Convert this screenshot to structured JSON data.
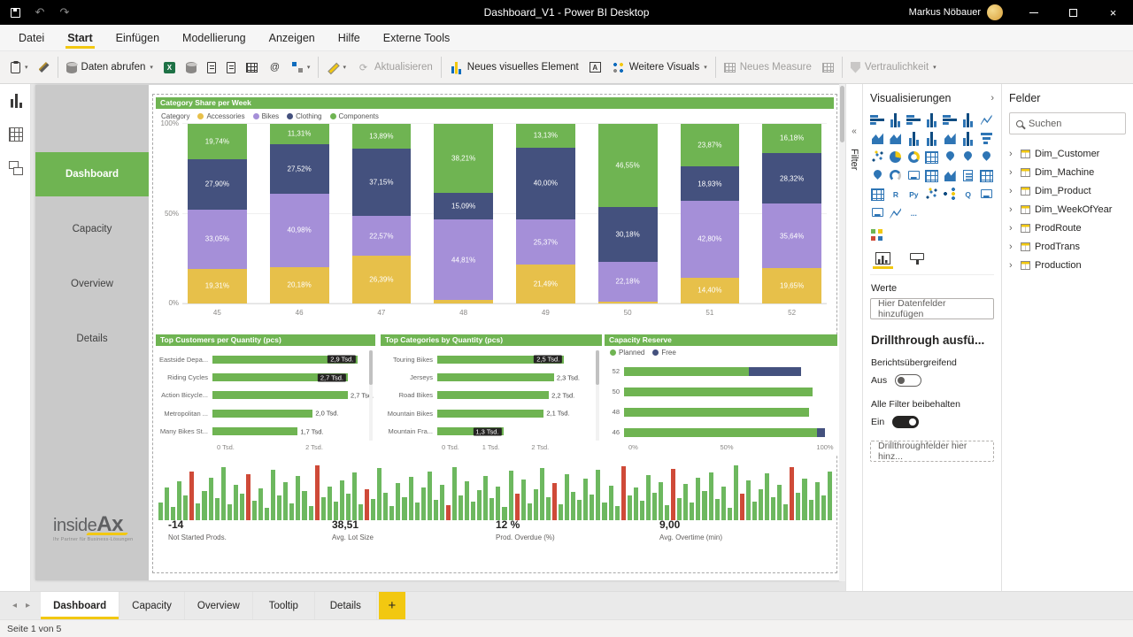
{
  "titlebar": {
    "title": "Dashboard_V1 - Power BI Desktop",
    "user": "Markus Nöbauer"
  },
  "menu": {
    "items": [
      "Datei",
      "Start",
      "Einfügen",
      "Modellierung",
      "Anzeigen",
      "Hilfe",
      "Externe Tools"
    ],
    "active": "Start"
  },
  "toolbar": {
    "get_data": "Daten abrufen",
    "refresh": "Aktualisieren",
    "new_visual": "Neues visuelles Element",
    "more_visuals": "Weitere Visuals",
    "new_measure": "Neues Measure",
    "sensitivity": "Vertraulichkeit"
  },
  "report_nav": {
    "items": [
      "Dashboard",
      "Capacity",
      "Overview",
      "Details"
    ],
    "active": "Dashboard"
  },
  "colors": {
    "accent": "#f2c811",
    "green": "#6fb452",
    "purple": "#a58fd8",
    "navy": "#44517e",
    "yellow": "#e7c04a",
    "red": "#cf4a38"
  },
  "chart_data": [
    {
      "id": "category_share",
      "type": "bar",
      "stacked": true,
      "title": "Category Share per Week",
      "legend_label": "Category",
      "legend_position": "top",
      "categories": [
        "45",
        "46",
        "47",
        "48",
        "49",
        "50",
        "51",
        "52"
      ],
      "series": [
        {
          "name": "Accessories",
          "color": "#e7c04a",
          "values": [
            19.31,
            20.18,
            26.39,
            1.89,
            21.49,
            1.09,
            14.4,
            19.65
          ],
          "labels": [
            "19,31%",
            "20,18%",
            "26,39%",
            "",
            "21,49%",
            "",
            "14,40%",
            "19,65%"
          ]
        },
        {
          "name": "Bikes",
          "color": "#a58fd8",
          "values": [
            33.05,
            40.98,
            22.57,
            44.81,
            25.37,
            22.18,
            42.8,
            35.64
          ],
          "labels": [
            "33,05%",
            "40,98%",
            "22,57%",
            "44,81%",
            "25,37%",
            "22,18%",
            "42,80%",
            "35,64%"
          ]
        },
        {
          "name": "Clothing",
          "color": "#44517e",
          "values": [
            27.9,
            27.52,
            37.15,
            15.09,
            40.0,
            30.18,
            18.93,
            28.32
          ],
          "labels": [
            "27,90%",
            "27,52%",
            "37,15%",
            "15,09%",
            "40,00%",
            "30,18%",
            "18,93%",
            "28,32%"
          ]
        },
        {
          "name": "Components",
          "color": "#6fb452",
          "values": [
            19.74,
            11.31,
            13.89,
            38.21,
            13.13,
            46.55,
            23.87,
            16.18
          ],
          "labels": [
            "19,74%",
            "11,31%",
            "13,89%",
            "38,21%",
            "13,13%",
            "46,55%",
            "23,87%",
            "16,18%"
          ]
        }
      ],
      "y_ticks": [
        {
          "label": "100%",
          "pct": 100
        },
        {
          "label": "50%",
          "pct": 50
        },
        {
          "label": "0%",
          "pct": 0
        }
      ],
      "ylim": [
        0,
        100
      ]
    },
    {
      "id": "top_customers",
      "type": "bar",
      "orientation": "horizontal",
      "title": "Top Customers per Quantity (pcs)",
      "categories": [
        "Eastside Depa...",
        "Riding Cycles",
        "Action Bicycle...",
        "Metropolitan ...",
        "Many Bikes St..."
      ],
      "values": [
        2.9,
        2.7,
        2.7,
        2.0,
        1.7
      ],
      "labels": [
        "2,9 Tsd.",
        "2,7 Tsd.",
        "2,7 Tsd.",
        "2,0 Tsd.",
        "1,7 Tsd."
      ],
      "label_inside": [
        true,
        true,
        false,
        false,
        false
      ],
      "x_ticks": [
        {
          "label": "0 Tsd.",
          "value": 0
        },
        {
          "label": "2 Tsd.",
          "value": 2
        }
      ],
      "xlim": [
        0,
        3
      ]
    },
    {
      "id": "top_categories",
      "type": "bar",
      "orientation": "horizontal",
      "title": "Top Categories by Quantity (pcs)",
      "categories": [
        "Touring Bikes",
        "Jerseys",
        "Road Bikes",
        "Mountain Bikes",
        "Mountain Fra..."
      ],
      "values": [
        2.5,
        2.3,
        2.2,
        2.1,
        1.3
      ],
      "labels": [
        "2,5 Tsd.",
        "2,3 Tsd.",
        "2,2 Tsd.",
        "2,1 Tsd.",
        "1,3 Tsd."
      ],
      "label_inside": [
        true,
        false,
        false,
        false,
        true
      ],
      "x_ticks": [
        {
          "label": "0 Tsd.",
          "value": 0
        },
        {
          "label": "1 Tsd.",
          "value": 1
        },
        {
          "label": "2 Tsd.",
          "value": 2
        }
      ],
      "xlim": [
        0,
        3
      ]
    },
    {
      "id": "capacity_reserve",
      "type": "bar",
      "orientation": "horizontal",
      "stacked": true,
      "title": "Capacity Reserve",
      "categories": [
        "52",
        "50",
        "48",
        "46"
      ],
      "series": [
        {
          "name": "Planned",
          "color": "#6fb452",
          "values": [
            62,
            94,
            92,
            96
          ]
        },
        {
          "name": "Free",
          "color": "#44517e",
          "values": [
            26,
            0,
            0,
            4
          ]
        }
      ],
      "x_ticks": [
        {
          "label": "0%",
          "value": 0
        },
        {
          "label": "50%",
          "value": 50
        },
        {
          "label": "100%",
          "value": 100
        }
      ],
      "xlim": [
        0,
        100
      ]
    },
    {
      "id": "production_timeline",
      "type": "area",
      "title": "",
      "color": "#6db85f",
      "alert_color": "#cf4a38",
      "values": [
        32,
        58,
        24,
        70,
        45,
        88,
        30,
        52,
        76,
        40,
        95,
        28,
        63,
        48,
        82,
        35,
        57,
        22,
        91,
        44,
        68,
        30,
        79,
        53,
        26,
        98,
        41,
        60,
        34,
        72,
        47,
        85,
        29,
        55,
        38,
        93,
        50,
        25,
        66,
        42,
        78,
        31,
        59,
        87,
        36,
        64,
        27,
        96,
        45,
        70,
        33,
        54,
        80,
        39,
        61,
        24,
        89,
        48,
        73,
        30,
        56,
        94,
        42,
        67,
        28,
        83,
        51,
        37,
        75,
        46,
        90,
        32,
        62,
        25,
        97,
        44,
        58,
        35,
        81,
        49,
        69,
        27,
        92,
        40,
        65,
        31,
        77,
        53,
        86,
        38,
        60,
        23,
        99,
        47,
        71,
        34,
        55,
        84,
        41,
        63,
        29,
        95,
        50,
        74,
        36,
        68,
        45,
        88
      ],
      "red_indices": [
        5,
        14,
        25,
        33,
        46,
        57,
        63,
        74,
        82,
        93,
        101
      ]
    }
  ],
  "kpis": [
    {
      "value": "-14",
      "label": "Not Started Prods."
    },
    {
      "value": "38,51",
      "label": "Avg. Lot Size"
    },
    {
      "value": "12 %",
      "label": "Prod. Overdue (%)"
    },
    {
      "value": "9,00",
      "label": "Avg. Overtime (min)"
    }
  ],
  "logo": {
    "name_light": "inside",
    "name_bold": "Ax",
    "tagline": "Ihr Partner für Business-Lösungen"
  },
  "filter_pane": {
    "label": "Filter"
  },
  "visualizations_pane": {
    "title": "Visualisierungen",
    "werte_label": "Werte",
    "field_well_placeholder": "Hier Datenfelder hinzufügen",
    "drillthrough_title": "Drillthrough ausfü...",
    "cross_report_label": "Berichtsübergreifend",
    "cross_report_toggle": "Aus",
    "keep_filters_label": "Alle Filter beibehalten",
    "keep_filters_toggle": "Ein",
    "drillthrough_placeholder": "Drillthroughfelder hier hinz...",
    "icons": [
      {
        "name": "stacked-bar-chart",
        "glyph": "colh"
      },
      {
        "name": "stacked-column-chart",
        "glyph": "colv"
      },
      {
        "name": "clustered-bar-chart",
        "glyph": "colh"
      },
      {
        "name": "clustered-column-chart",
        "glyph": "colv"
      },
      {
        "name": "100-stacked-bar-chart",
        "glyph": "colh"
      },
      {
        "name": "100-stacked-column-chart",
        "glyph": "colv"
      },
      {
        "name": "line-chart",
        "glyph": "line"
      },
      {
        "name": "area-chart",
        "glyph": "area"
      },
      {
        "name": "stacked-area-chart",
        "glyph": "area"
      },
      {
        "name": "line-and-stacked-column-chart",
        "glyph": "colv"
      },
      {
        "name": "line-and-clustered-column-chart",
        "glyph": "colv"
      },
      {
        "name": "ribbon-chart",
        "glyph": "area"
      },
      {
        "name": "waterfall-chart",
        "glyph": "colv"
      },
      {
        "name": "funnel-chart",
        "glyph": "funnel"
      },
      {
        "name": "scatter-chart",
        "glyph": "scatter"
      },
      {
        "name": "pie-chart",
        "glyph": "pie"
      },
      {
        "name": "donut-chart",
        "glyph": "donut"
      },
      {
        "name": "treemap",
        "glyph": "grid"
      },
      {
        "name": "map",
        "glyph": "pin"
      },
      {
        "name": "filled-map",
        "glyph": "pin"
      },
      {
        "name": "shape-map",
        "glyph": "pin"
      },
      {
        "name": "azure-map",
        "glyph": "pin"
      },
      {
        "name": "gauge",
        "glyph": "gauge"
      },
      {
        "name": "card",
        "glyph": "card"
      },
      {
        "name": "multi-row-card",
        "glyph": "grid"
      },
      {
        "name": "kpi",
        "glyph": "area"
      },
      {
        "name": "slicer",
        "glyph": "slicer"
      },
      {
        "name": "table",
        "glyph": "grid"
      },
      {
        "name": "matrix",
        "glyph": "grid"
      },
      {
        "name": "r-script-visual",
        "glyph": "text",
        "text": "R"
      },
      {
        "name": "python-visual",
        "glyph": "text",
        "text": "Py"
      },
      {
        "name": "key-influencers",
        "glyph": "scatter"
      },
      {
        "name": "decomposition-tree",
        "glyph": "tree"
      },
      {
        "name": "qa-visual",
        "glyph": "text",
        "text": "Q"
      },
      {
        "name": "smart-narrative",
        "glyph": "card"
      },
      {
        "name": "paginated-report",
        "glyph": "card"
      },
      {
        "name": "metrics",
        "glyph": "line"
      },
      {
        "name": "more-visuals-options",
        "glyph": "text",
        "text": "..."
      }
    ]
  },
  "fields_pane": {
    "title": "Felder",
    "search_placeholder": "Suchen",
    "tables": [
      "Dim_Customer",
      "Dim_Machine",
      "Dim_Product",
      "Dim_WeekOfYear",
      "ProdRoute",
      "ProdTrans",
      "Production"
    ]
  },
  "page_tabs": {
    "tabs": [
      "Dashboard",
      "Capacity",
      "Overview",
      "Tooltip",
      "Details"
    ],
    "active": "Dashboard",
    "add_label": "+"
  },
  "statusbar": {
    "text": "Seite 1 von 5"
  }
}
